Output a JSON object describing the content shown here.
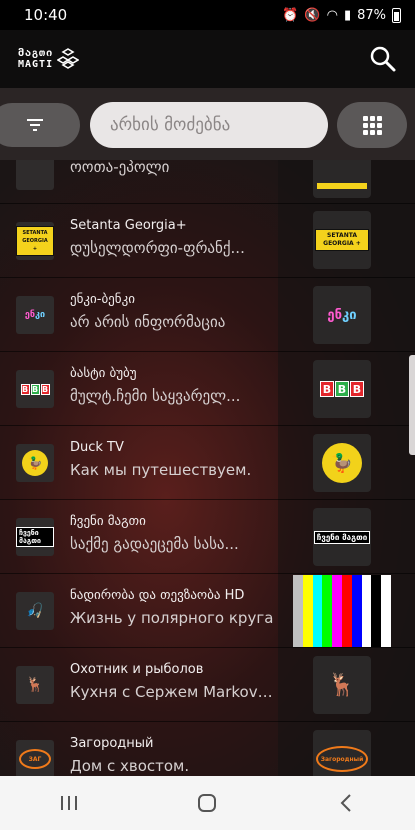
{
  "status_bar": {
    "time": "10:40",
    "battery": "87%"
  },
  "header": {
    "logo_geo": "მაგთი",
    "logo_lat": "MAGTI"
  },
  "toolbar": {
    "search_placeholder": "არხის მოძებნა"
  },
  "channels": [
    {
      "title": "",
      "program": "ოოთა-ეპოლი",
      "logo": ""
    },
    {
      "title": "Setanta Georgia+",
      "program": "დუსელდორფი-ფრანქ...",
      "logo": "SETANTA GEORGIA +"
    },
    {
      "title": "ენკი-ბენკი",
      "program": "არ არის ინფორმაცია",
      "logo": "enki"
    },
    {
      "title": "ბასტი ბუბუ",
      "program": "მულტ.ჩემი საყვარელ...",
      "logo": "BBB"
    },
    {
      "title": "Duck TV",
      "program": "Как мы путешествуем.",
      "logo": "duck"
    },
    {
      "title": "ჩვენი მაგთი",
      "program": "საქმე გადაეცემა სასა...",
      "logo": "MAGTI"
    },
    {
      "title": "ნადირობა და თევზაობა HD",
      "program": "Жизнь у полярного круга",
      "logo": ""
    },
    {
      "title": "Охотник и рыболов",
      "program": "Кухня с Сержем Markovi...",
      "logo": ""
    },
    {
      "title": "Загородный",
      "program": "Дом с хвостом.",
      "logo": "Загородный"
    }
  ],
  "colors": {
    "accent": "#f4d21c",
    "bar_bg": "#5b5858"
  }
}
